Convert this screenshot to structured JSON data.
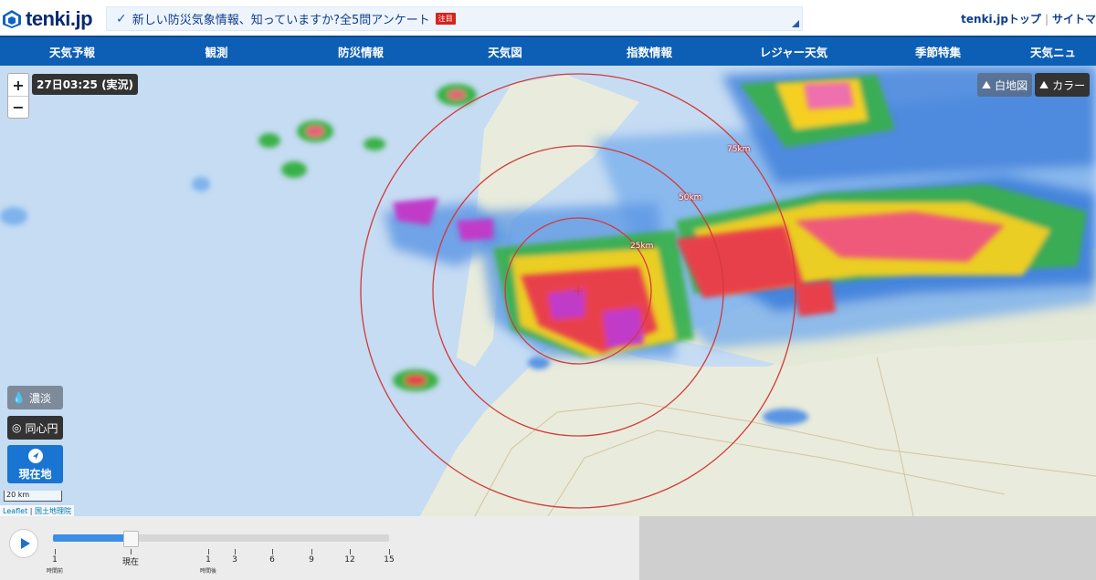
{
  "header": {
    "logo_text": "tenki.jp",
    "banner_text": "新しい防災気象情報、知っていますか?全5問アンケート",
    "banner_badge": "注目",
    "links": [
      "tenki.jpトップ",
      "サイトマ"
    ]
  },
  "nav": {
    "items": [
      "天気予報",
      "観測",
      "防災情報",
      "天気図",
      "指数情報",
      "レジャー天気",
      "季節特集",
      "天気ニュ"
    ]
  },
  "map": {
    "timestamp": "27日03:25 (実況)",
    "zoom_in": "+",
    "zoom_out": "−",
    "btn_white_map": "白地図",
    "btn_color": "カラー",
    "btn_intensity": "濃淡",
    "btn_concentric": "同心円",
    "btn_location": "現在地",
    "scale_label": "20 km",
    "ring_labels": [
      "25km",
      "50km",
      "75km"
    ],
    "attribution_leaflet": "Leaflet",
    "attribution_sep": " | ",
    "attribution_gsi": "国土地理院",
    "colors": {
      "nav": "#0d5fb5",
      "location_button": "#1974d2",
      "ring": "#d23a3a"
    }
  },
  "timeline": {
    "progress": 0.24,
    "ticks": [
      {
        "label": "1",
        "sub": "時間前"
      },
      {
        "label": "現在",
        "sub": ""
      },
      {
        "label": "1",
        "sub": "時間後"
      },
      {
        "label": "3",
        "sub": ""
      },
      {
        "label": "6",
        "sub": ""
      },
      {
        "label": "9",
        "sub": ""
      },
      {
        "label": "12",
        "sub": ""
      },
      {
        "label": "15",
        "sub": ""
      }
    ]
  }
}
